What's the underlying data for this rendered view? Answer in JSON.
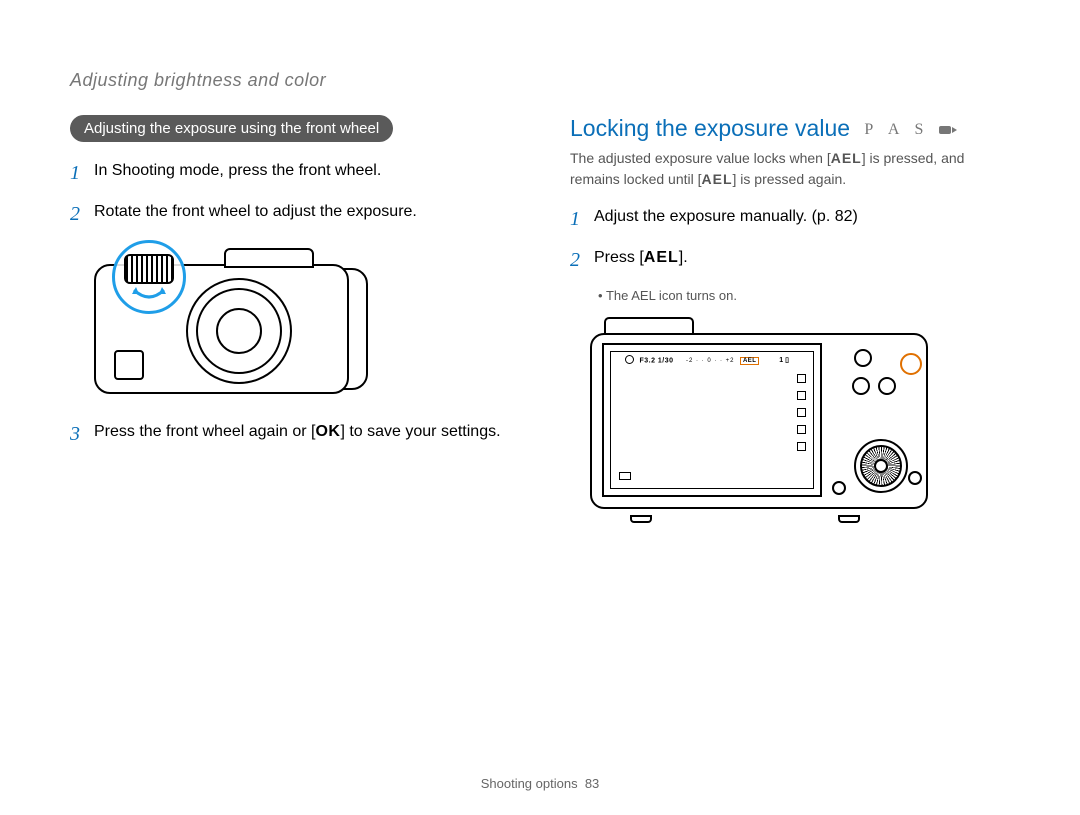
{
  "breadcrumb": "Adjusting brightness and color",
  "left": {
    "pill": "Adjusting the exposure using the front wheel",
    "step1": "In Shooting mode, press the front wheel.",
    "step2": "Rotate the front wheel to adjust the exposure.",
    "step3_a": "Press the front wheel again or [",
    "ok": "OK",
    "step3_b": "] to save your settings."
  },
  "right": {
    "heading": "Locking the exposure value",
    "modes": "P A S",
    "sub_a": "The adjusted exposure value locks when [",
    "ael": "AEL",
    "sub_b": "] is pressed, and remains locked until [",
    "sub_c": "] is pressed again.",
    "step1": "Adjust the exposure manually. (p. 82)",
    "step2_a": "Press [",
    "step2_b": "].",
    "bullet": "The AEL icon turns on.",
    "screen_info": "F3.2 1/30",
    "screen_ael_badge": "AEL",
    "screen_count": "1"
  },
  "footer": {
    "section": "Shooting options",
    "page": "83"
  }
}
